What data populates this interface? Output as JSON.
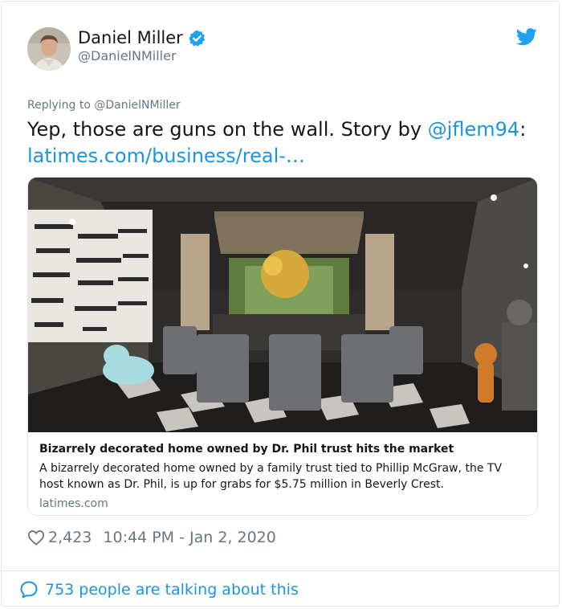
{
  "user": {
    "display_name": "Daniel Miller",
    "handle": "@DanielNMiller",
    "verified": true,
    "avatar_icon": "avatar-photo"
  },
  "brand": {
    "icon": "twitter-bird-icon",
    "color": "#1da1f2"
  },
  "tweet": {
    "replying_to": "Replying to @DanielNMiller",
    "text_before": "Yep, those are guns on the wall. Story by ",
    "mention": "@jflem94",
    "text_after": ":",
    "link": "latimes.com/business/real-…"
  },
  "link_card": {
    "image_icon": "dining-room-photo",
    "title": "Bizarrely decorated home owned by Dr. Phil trust hits the market",
    "description": "A bizarrely decorated home owned by a family trust tied to Phillip McGraw, the TV host known as Dr. Phil, is up for grabs for $5.75 million in Beverly Crest.",
    "domain": "latimes.com"
  },
  "meta": {
    "likes": "2,423",
    "timestamp": "10:44 PM - Jan 2, 2020",
    "like_icon": "heart-icon"
  },
  "footer": {
    "talking": "753 people are talking about this",
    "icon": "speech-bubble-icon"
  },
  "colors": {
    "link": "#1b95e0",
    "text": "#14171a",
    "muted": "#657786",
    "border": "#e1e8ed"
  }
}
